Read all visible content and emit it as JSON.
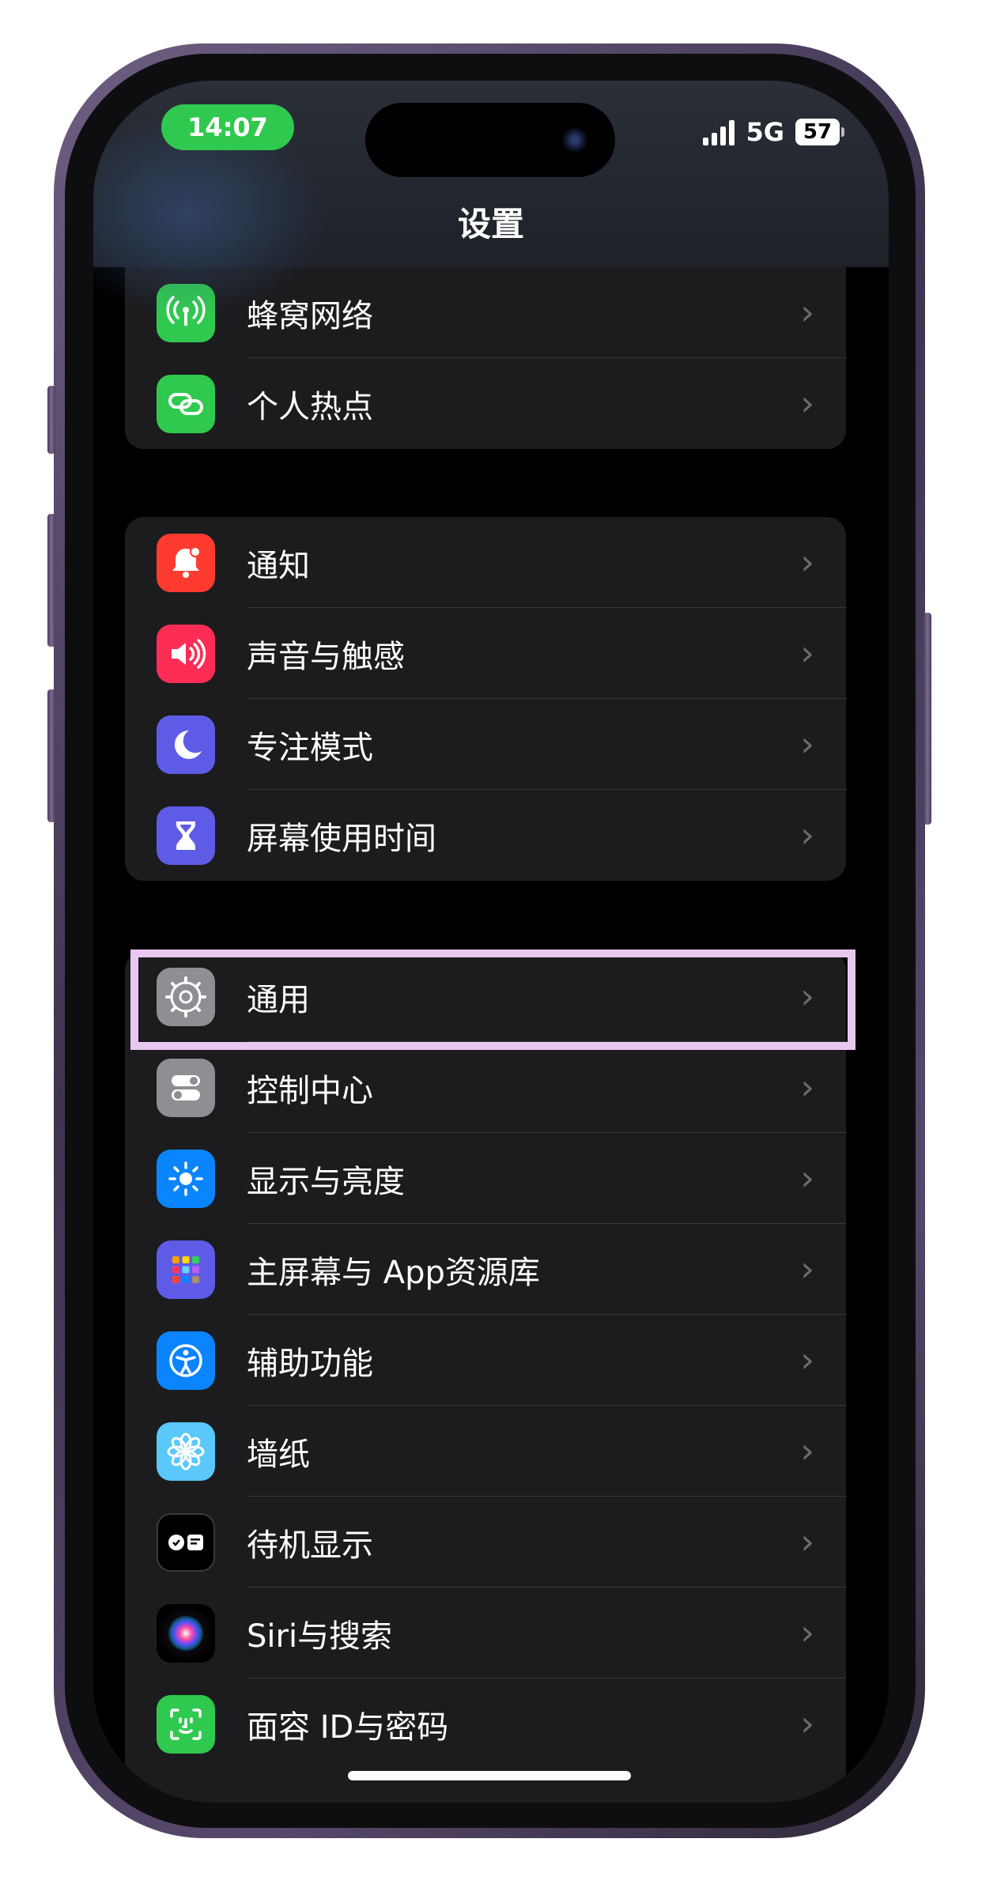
{
  "status_bar": {
    "time": "14:07",
    "network": "5G",
    "battery": "57"
  },
  "nav": {
    "title": "设置"
  },
  "groups": [
    {
      "items": [
        {
          "label": "蜂窝网络",
          "icon": "antenna-icon",
          "color": "#30c94f"
        },
        {
          "label": "个人热点",
          "icon": "link-icon",
          "color": "#30c94f"
        }
      ]
    },
    {
      "items": [
        {
          "label": "通知",
          "icon": "bell-icon",
          "color": "#ff3b30"
        },
        {
          "label": "声音与触感",
          "icon": "speaker-icon",
          "color": "#ff2d55"
        },
        {
          "label": "专注模式",
          "icon": "moon-icon",
          "color": "#5e5ce6"
        },
        {
          "label": "屏幕使用时间",
          "icon": "hourglass-icon",
          "color": "#5e5ce6"
        }
      ]
    },
    {
      "items": [
        {
          "label": "通用",
          "icon": "gear-icon",
          "color": "#8e8e93"
        },
        {
          "label": "控制中心",
          "icon": "toggles-icon",
          "color": "#8e8e93"
        },
        {
          "label": "显示与亮度",
          "icon": "sun-icon",
          "color": "#0a84ff"
        },
        {
          "label": "主屏幕与 App资源库",
          "icon": "app-grid-icon",
          "color": "#5e5ce6"
        },
        {
          "label": "辅助功能",
          "icon": "accessibility-icon",
          "color": "#0a84ff"
        },
        {
          "label": "墙纸",
          "icon": "flower-icon",
          "color": "#5ac8fa"
        },
        {
          "label": "待机显示",
          "icon": "standby-icon",
          "color": "#000000"
        },
        {
          "label": "Siri与搜索",
          "icon": "siri-icon",
          "color": "#1c1c1e"
        },
        {
          "label": "面容 ID与密码",
          "icon": "faceid-icon",
          "color": "#30c94f"
        }
      ]
    }
  ],
  "highlight": {
    "target": "通用",
    "color": "#e9c8f0"
  },
  "chevron": "›"
}
